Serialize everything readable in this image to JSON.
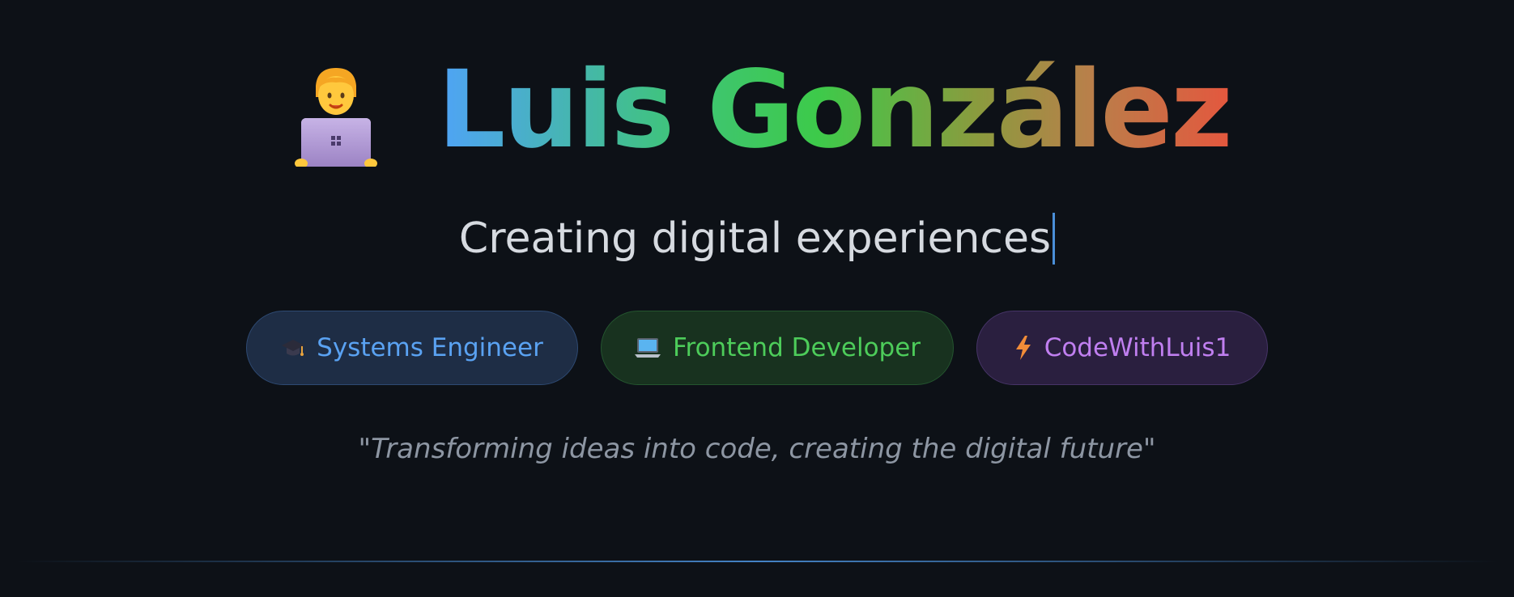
{
  "hero": {
    "avatar_icon": "technologist-icon",
    "name": "Luis González",
    "gradient_colors": [
      "#4fa3f7",
      "#3fc47a",
      "#3dca4a",
      "#8a9b3e",
      "#b8804a",
      "#e4573e"
    ]
  },
  "subtitle": {
    "text": "Creating digital experiences",
    "cursor_color": "#4a8fd8"
  },
  "badges": [
    {
      "icon": "graduation-cap-icon",
      "label": "Systems Engineer",
      "color": "#5aa2f2"
    },
    {
      "icon": "laptop-icon",
      "label": "Frontend Developer",
      "color": "#4dcc5a"
    },
    {
      "icon": "lightning-icon",
      "label": "CodeWithLuis1",
      "color": "#c07ff0"
    }
  ],
  "quote": {
    "text": "\"Transforming ideas into code, creating the digital future\""
  },
  "theme": {
    "background": "#0d1117",
    "divider_color": "#4a8fd8"
  }
}
